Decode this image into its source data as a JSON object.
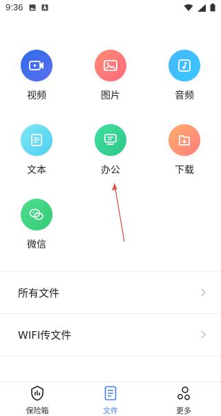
{
  "status_bar": {
    "time": "9:36"
  },
  "grid": [
    {
      "label": "视频",
      "colors": [
        "#2e6be6",
        "#5a6ff0"
      ],
      "icon": "video-icon"
    },
    {
      "label": "图片",
      "colors": [
        "#ff8a73",
        "#ff6b7d"
      ],
      "icon": "image-icon"
    },
    {
      "label": "音频",
      "colors": [
        "#49b9ff",
        "#36c6ff"
      ],
      "icon": "music-icon"
    },
    {
      "label": "文本",
      "colors": [
        "#7de6f6",
        "#4fd0ef"
      ],
      "icon": "text-doc-icon"
    },
    {
      "label": "办公",
      "colors": [
        "#3fe0a0",
        "#2fc68a"
      ],
      "icon": "office-icon"
    },
    {
      "label": "下载",
      "colors": [
        "#ffb06d",
        "#ff7b7b"
      ],
      "icon": "download-icon"
    },
    {
      "label": "微信",
      "colors": [
        "#4fe08f",
        "#34c977"
      ],
      "icon": "wechat-icon"
    }
  ],
  "list": [
    {
      "label": "所有文件"
    },
    {
      "label": "WIFI传文件"
    }
  ],
  "bottom_nav": [
    {
      "label": "保险箱",
      "icon": "safe-icon"
    },
    {
      "label": "文件",
      "icon": "file-icon",
      "active": true
    },
    {
      "label": "更多",
      "icon": "more-icon"
    }
  ],
  "accent_color": "#3f7cf6"
}
